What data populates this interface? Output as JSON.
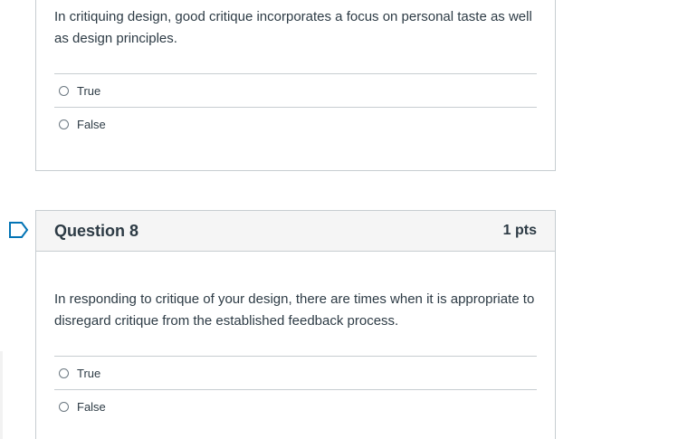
{
  "question7": {
    "text": "In critiquing design, good critique incorporates a focus on personal taste as well as design principles.",
    "answers": [
      "True",
      "False"
    ]
  },
  "question8": {
    "title": "Question 8",
    "points": "1 pts",
    "text": "In responding to critique of your design, there are times when it is appropriate to disregard critique from the established feedback process.",
    "answers": [
      "True",
      "False"
    ]
  },
  "colors": {
    "border": "#c7cdd1",
    "header_bg": "#f5f5f5",
    "text": "#2d3b45",
    "flag": "#0374b5"
  },
  "icons": {
    "flag": "bookmark-flag-icon",
    "radio": "radio-button-icon"
  }
}
